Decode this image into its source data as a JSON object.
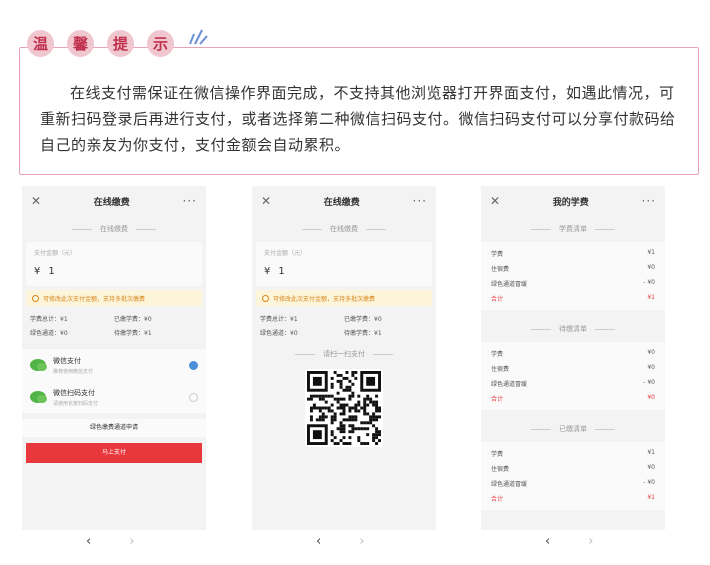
{
  "tip": {
    "title_chars": [
      "温",
      "馨",
      "提",
      "示"
    ],
    "text": "在线支付需保证在微信操作界面完成，不支持其他浏览器打开界面支付，如遇此情况，可重新扫码登录后再进行支付，或者选择第二种微信扫码支付。微信扫码支付可以分享付款码给自己的亲友为你支付，支付金额会自动累积。"
  },
  "phone1": {
    "close": "✕",
    "title": "在线缴费",
    "more": "···",
    "section": "在线缴费",
    "amount_label": "支付金额（元）",
    "currency": "¥",
    "amount": "1",
    "notice": "可修改此次支付金额，支持多批次缴费",
    "stats": [
      "学费总计：¥1",
      "已缴学费：¥0",
      "绿色通道：¥0",
      "待缴学费：¥1"
    ],
    "opt1_title": "微信支付",
    "opt1_sub": "推荐使用微信支付",
    "opt2_title": "微信扫码支付",
    "opt2_sub": "请使用长按扫码支付",
    "green_link": "绿色缴费通道申请",
    "pay_button": "马上支付"
  },
  "phone2": {
    "close": "✕",
    "title": "在线缴费",
    "more": "···",
    "section": "在线缴费",
    "amount_label": "支付金额（元）",
    "currency": "¥",
    "amount": "1",
    "notice": "可修改此次支付金额，支持多批次缴费",
    "stats": [
      "学费总计：¥1",
      "已缴学费：¥0",
      "绿色通道：¥0",
      "待缴学费：¥1"
    ],
    "scan_title": "请扫一扫支付"
  },
  "phone3": {
    "close": "✕",
    "title": "我的学费",
    "more": "···",
    "sec1": "学费清单",
    "sec2": "待缴清单",
    "sec3": "已缴清单",
    "rows1": [
      [
        "学费",
        "¥1"
      ],
      [
        "住宿费",
        "¥0"
      ],
      [
        "绿色通道冒缓",
        "- ¥0"
      ],
      [
        "合计",
        "¥1"
      ]
    ],
    "rows2": [
      [
        "学费",
        "¥0"
      ],
      [
        "住宿费",
        "¥0"
      ],
      [
        "绿色通道冒缓",
        "- ¥0"
      ],
      [
        "合计",
        "¥0"
      ]
    ],
    "rows3": [
      [
        "学费",
        "¥1"
      ],
      [
        "住宿费",
        "¥0"
      ],
      [
        "绿色通道冒缓",
        "- ¥0"
      ],
      [
        "合计",
        "¥1"
      ]
    ]
  },
  "nav": {
    "back": "‹",
    "forward": "›"
  }
}
